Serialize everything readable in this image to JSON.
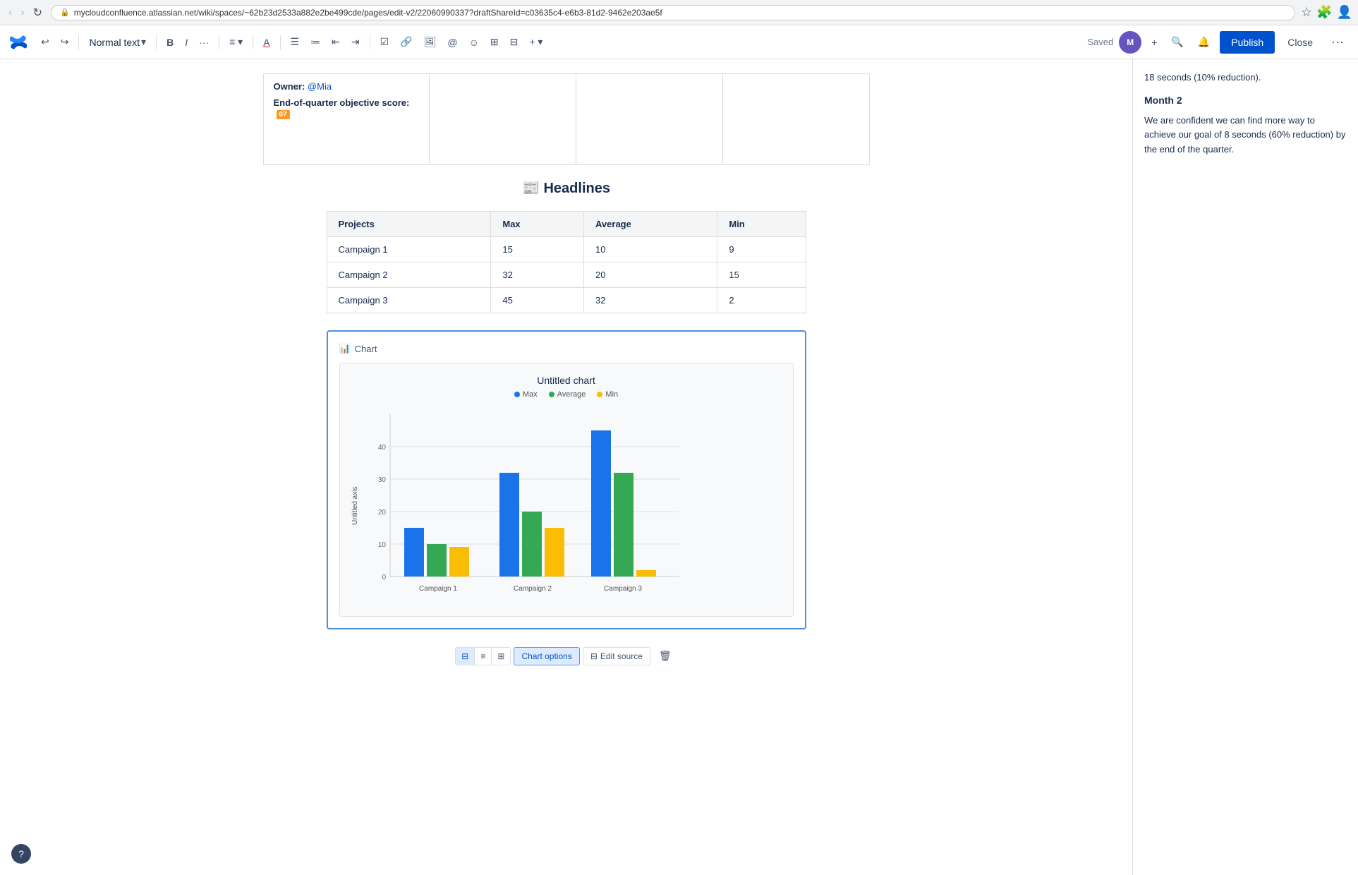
{
  "browser": {
    "url": "mycloudconfluence.atlassian.net/wiki/spaces/~62b23d2533a882e2be499cde/pages/edit-v2/22060990337?draftShareId=c03635c4-e6b3-81d2-9462e203ae5f"
  },
  "toolbar": {
    "logo_label": "Confluence",
    "undo_label": "↩",
    "redo_label": "↪",
    "text_style": "Normal text",
    "bold": "B",
    "italic": "I",
    "more_text": "...",
    "align": "≡",
    "text_color": "A",
    "bullet_list": "•",
    "numbered_list": "1.",
    "outdent": "⇤",
    "indent": "⇥",
    "task": "☑",
    "link": "🔗",
    "image": "🖼",
    "mention": "@",
    "emoji": "☺",
    "table": "⊞",
    "layout": "⊟",
    "more_insert": "+",
    "saved": "Saved",
    "add_btn": "+",
    "search_icon": "🔍",
    "notification_icon": "🔔",
    "publish": "Publish",
    "close": "Close",
    "more": "..."
  },
  "sidebar": {
    "month2_title": "Month 2",
    "month2_text": "We are confident we can find more way to achieve our goal of 8 seconds (60% reduction) by the end of the quarter.",
    "prev_text": "18 seconds (10% reduction)."
  },
  "top_section": {
    "owner_label": "Owner:",
    "owner_value": "@Mia",
    "eq_label": "End-of-quarter objective score:",
    "eq_badge": "07"
  },
  "headlines": {
    "title": "Headlines",
    "emoji": "📰",
    "table": {
      "headers": [
        "Projects",
        "Max",
        "Average",
        "Min"
      ],
      "rows": [
        [
          "Campaign 1",
          "15",
          "10",
          "9"
        ],
        [
          "Campaign 2",
          "32",
          "20",
          "15"
        ],
        [
          "Campaign 3",
          "45",
          "32",
          "2"
        ]
      ]
    }
  },
  "chart": {
    "header_label": "Chart",
    "chart_icon": "📊",
    "title": "Untitled chart",
    "y_axis_label": "Untitled axis",
    "legend": [
      {
        "label": "Max",
        "color": "#1a73e8"
      },
      {
        "label": "Average",
        "color": "#34a853"
      },
      {
        "label": "Min",
        "color": "#fbbc04"
      }
    ],
    "campaigns": [
      {
        "name": "Campaign 1",
        "max": 15,
        "avg": 10,
        "min": 9
      },
      {
        "name": "Campaign 2",
        "max": 32,
        "avg": 20,
        "min": 15
      },
      {
        "name": "Campaign 3",
        "max": 45,
        "avg": 32,
        "min": 2
      }
    ],
    "y_max": 50,
    "y_ticks": [
      0,
      10,
      20,
      30,
      40
    ],
    "toolbar": {
      "view1": "⊟",
      "view2": "≡",
      "view3": "⊞",
      "chart_options": "Chart options",
      "edit_source": "Edit source",
      "delete": "🗑"
    }
  }
}
